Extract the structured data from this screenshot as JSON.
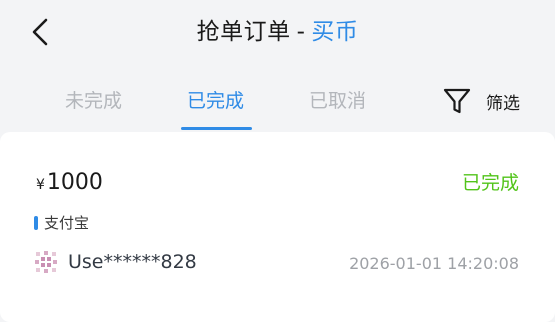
{
  "header": {
    "title_main": "抢单订单",
    "title_separator": "-",
    "title_accent": "买币",
    "back_icon": "chevron-left-icon"
  },
  "tabs": [
    {
      "label": "未完成",
      "active": false
    },
    {
      "label": "已完成",
      "active": true
    },
    {
      "label": "已取消",
      "active": false
    }
  ],
  "filter": {
    "label": "筛选",
    "icon": "funnel-icon"
  },
  "order": {
    "currency_symbol": "¥",
    "amount": "1000",
    "status": "已完成",
    "payment_method": "支付宝",
    "username": "Use******828",
    "time": "2026-01-01 14:20:08",
    "avatar_icon": "avatar-pattern-icon"
  },
  "colors": {
    "accent": "#2f8be6",
    "success": "#52c41a",
    "muted": "#b3b6bb",
    "background": "#f3f4f6"
  }
}
